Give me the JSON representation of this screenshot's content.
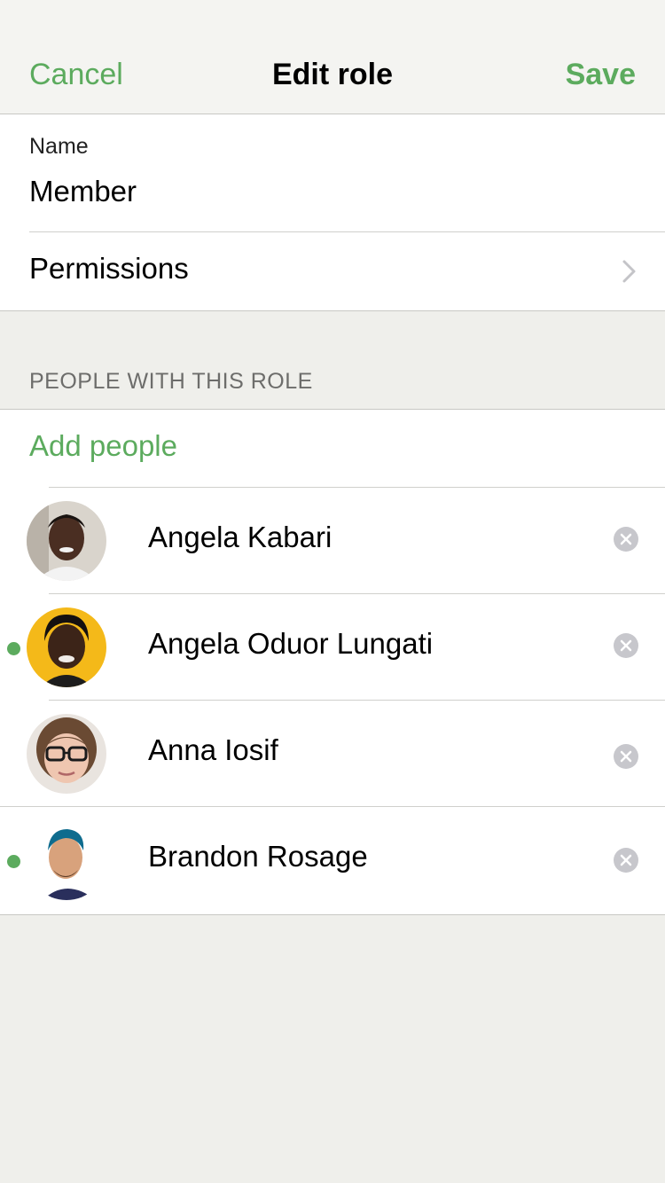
{
  "nav": {
    "cancel_label": "Cancel",
    "title": "Edit role",
    "save_label": "Save"
  },
  "form": {
    "name_label": "Name",
    "name_value": "Member",
    "permissions_label": "Permissions"
  },
  "people_section": {
    "header": "PEOPLE WITH THIS ROLE",
    "add_label": "Add people",
    "people": [
      {
        "name": "Angela Kabari",
        "online": false
      },
      {
        "name": "Angela Oduor Lungati",
        "online": true
      },
      {
        "name": "Anna Iosif",
        "online": false
      },
      {
        "name": "Brandon Rosage",
        "online": true
      }
    ]
  },
  "colors": {
    "accent": "#5cab5e",
    "background": "#efefeb",
    "nav_background": "#f4f4f1"
  },
  "icons": {
    "chevron": "chevron-right-icon",
    "remove": "remove-circle-icon"
  }
}
